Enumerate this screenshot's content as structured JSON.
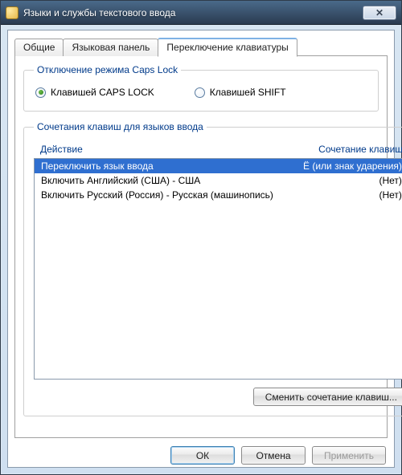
{
  "window": {
    "title": "Языки и службы текстового ввода",
    "close_glyph": "✕"
  },
  "tabs": [
    {
      "label": "Общие"
    },
    {
      "label": "Языковая панель"
    },
    {
      "label": "Переключение клавиатуры"
    }
  ],
  "capslock": {
    "legend": "Отключение режима Caps Lock",
    "opt_caps": "Клавишей CAPS LOCK",
    "opt_shift": "Клавишей SHIFT",
    "selected": "caps"
  },
  "hotkeys": {
    "legend": "Сочетания клавиш для языков ввода",
    "col_action": "Действие",
    "col_combo": "Сочетание клавиш",
    "rows": [
      {
        "action": "Переключить язык ввода",
        "combo": "Ё (или знак ударения)",
        "selected": true
      },
      {
        "action": "Включить Английский (США) - США",
        "combo": "(Нет)",
        "selected": false
      },
      {
        "action": "Включить Русский (Россия) - Русская (машинопись)",
        "combo": "(Нет)",
        "selected": false
      }
    ],
    "change_btn": "Сменить сочетание клавиш..."
  },
  "buttons": {
    "ok": "ОК",
    "cancel": "Отмена",
    "apply": "Применить"
  }
}
